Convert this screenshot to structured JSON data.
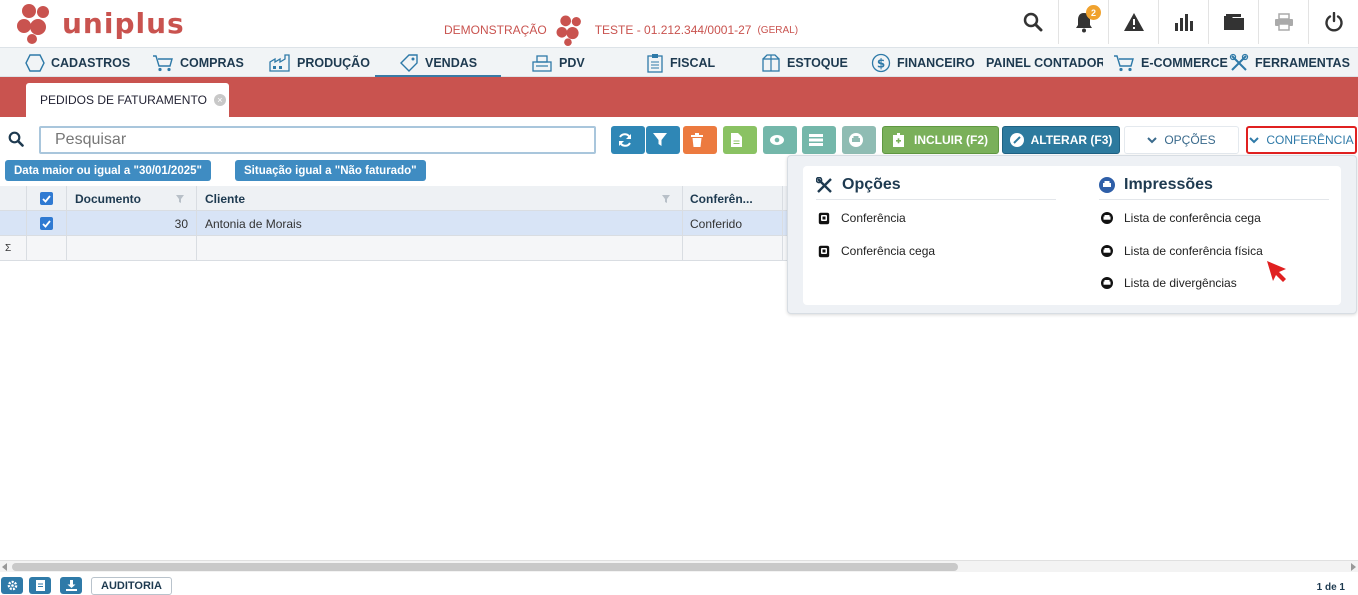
{
  "header": {
    "logo_text": "uniplus",
    "demo_label": "DEMONSTRAÇÃO",
    "company": "TESTE - 01.212.344/0001-27",
    "company_scope": "(GERAL)",
    "notification_count": "2",
    "icons": [
      "search-icon",
      "bell-icon",
      "warning-icon",
      "chart-icon",
      "folder-icon",
      "printer-icon",
      "power-icon"
    ]
  },
  "menu": {
    "items": [
      {
        "label": "CADASTROS",
        "icon": "hexagon-icon"
      },
      {
        "label": "COMPRAS",
        "icon": "cart-icon"
      },
      {
        "label": "PRODUÇÃO",
        "icon": "factory-icon"
      },
      {
        "label": "VENDAS",
        "icon": "tag-icon"
      },
      {
        "label": "PDV",
        "icon": "register-icon"
      },
      {
        "label": "FISCAL",
        "icon": "clipboard-icon"
      },
      {
        "label": "ESTOQUE",
        "icon": "box-icon"
      },
      {
        "label": "FINANCEIRO",
        "icon": "dollar-icon"
      },
      {
        "label": "PAINEL CONTADOR",
        "icon": "document-icon"
      },
      {
        "label": "E-COMMERCE",
        "icon": "cart-icon"
      },
      {
        "label": "FERRAMENTAS",
        "icon": "tools-icon"
      }
    ],
    "active": "VENDAS"
  },
  "tab": {
    "label": "PEDIDOS DE FATURAMENTO"
  },
  "search": {
    "placeholder": "Pesquisar"
  },
  "toolbar": {
    "include_label": "INCLUIR (F2)",
    "alter_label": "ALTERAR (F3)",
    "options_label": "OPÇÕES",
    "conference_label": "CONFERÊNCIA"
  },
  "filters": [
    "Data maior ou igual a \"30/01/2025\"",
    "Situação igual a \"Não faturado\""
  ],
  "grid": {
    "columns": [
      "Documento",
      "Cliente",
      "Conferên..."
    ],
    "rows": [
      {
        "documento": "30",
        "cliente": "Antonia de Morais",
        "conferencia": "Conferido",
        "checked": true
      }
    ],
    "sum_symbol": "Σ"
  },
  "dropdown": {
    "options_title": "Opções",
    "options_items": [
      "Conferência",
      "Conferência cega"
    ],
    "prints_title": "Impressões",
    "prints_items": [
      "Lista de conferência cega",
      "Lista de conferência física",
      "Lista de divergências"
    ]
  },
  "footer": {
    "audit_label": "AUDITORIA",
    "page_info": "1 de 1"
  },
  "colors": {
    "brand_red": "#c9534f",
    "primary_blue": "#2f87b6",
    "highlight_red": "#e02020"
  }
}
